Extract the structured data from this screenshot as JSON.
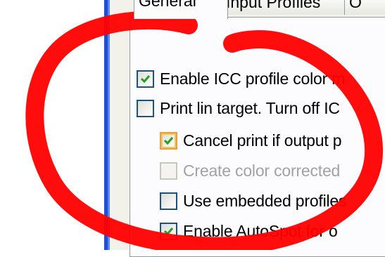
{
  "tabs": [
    {
      "label": "General",
      "active": true
    },
    {
      "label": "Input Profiles",
      "active": false
    },
    {
      "label": "O",
      "active": false
    }
  ],
  "options": [
    {
      "label": "Enable ICC profile color m",
      "checked": true,
      "enabled": true,
      "hover": false
    },
    {
      "label": "Print lin target. Turn off IC",
      "checked": false,
      "enabled": true,
      "hover": false
    },
    {
      "label": "Cancel print if output p",
      "checked": true,
      "enabled": true,
      "hover": true
    },
    {
      "label": "Create color corrected",
      "checked": false,
      "enabled": false,
      "hover": false
    },
    {
      "label": "Use embedded profiles",
      "checked": false,
      "enabled": true,
      "hover": false
    },
    {
      "label": "Enable AutoSpot for o",
      "checked": true,
      "enabled": true,
      "hover": false
    }
  ],
  "colors": {
    "annotation": "#ff0000",
    "check": "#21a121",
    "border_blue": "#1b4fd6",
    "panel": "#f3f2ea"
  },
  "icons": {
    "checkmark": "checkmark-icon",
    "annotation": "red-circle-annotation"
  }
}
